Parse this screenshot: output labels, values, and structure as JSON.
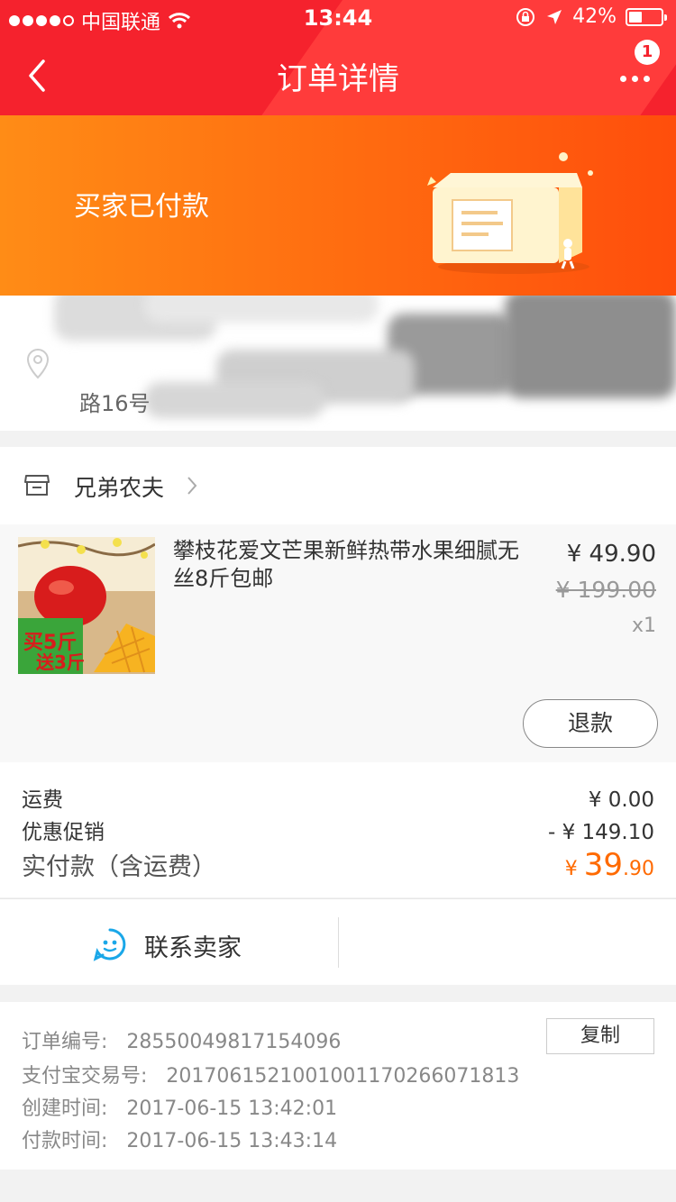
{
  "status_bar": {
    "carrier": "中国联通",
    "time": "13:44",
    "battery_percent": "42%",
    "battery_level": 0.42,
    "signal_bars_filled": 4,
    "signal_bars_total": 5
  },
  "nav": {
    "title": "订单详情",
    "badge_count": "1",
    "back_icon": "chevron-left-icon",
    "more_icon": "more-dots-icon"
  },
  "banner": {
    "status_text": "买家已付款"
  },
  "address": {
    "visible_fragment": "路16号"
  },
  "shop": {
    "name": "兄弟农夫"
  },
  "product": {
    "title": "攀枝花爱文芒果新鲜热带水果细腻无丝8斤包邮",
    "thumb_tag_top": "买5斤",
    "thumb_tag_bottom": "送3斤",
    "price": "¥ 49.90",
    "original_price": "¥ 199.00",
    "quantity": "x1",
    "refund_label": "退款"
  },
  "summary": {
    "shipping_label": "运费",
    "shipping_value": "¥ 0.00",
    "discount_label": "优惠促销",
    "discount_value": "- ¥ 149.10",
    "paid_label": "实付款（含运费）",
    "paid_currency": "¥ ",
    "paid_int": "39",
    "paid_dec": ".90"
  },
  "contact": {
    "label": "联系卖家"
  },
  "order_info": {
    "order_no_label": "订单编号:",
    "order_no": "28550049817154096",
    "alipay_label": "支付宝交易号:",
    "alipay_no": "2017061521001001170266071813",
    "created_label": "创建时间:",
    "created": "2017-06-15 13:42:01",
    "paid_label": "付款时间:",
    "paid": "2017-06-15 13:43:14",
    "copy_label": "复制"
  },
  "colors": {
    "nav_red": "#f5222d",
    "banner_orange": "#ff6a10",
    "price_orange": "#ff6a00"
  }
}
